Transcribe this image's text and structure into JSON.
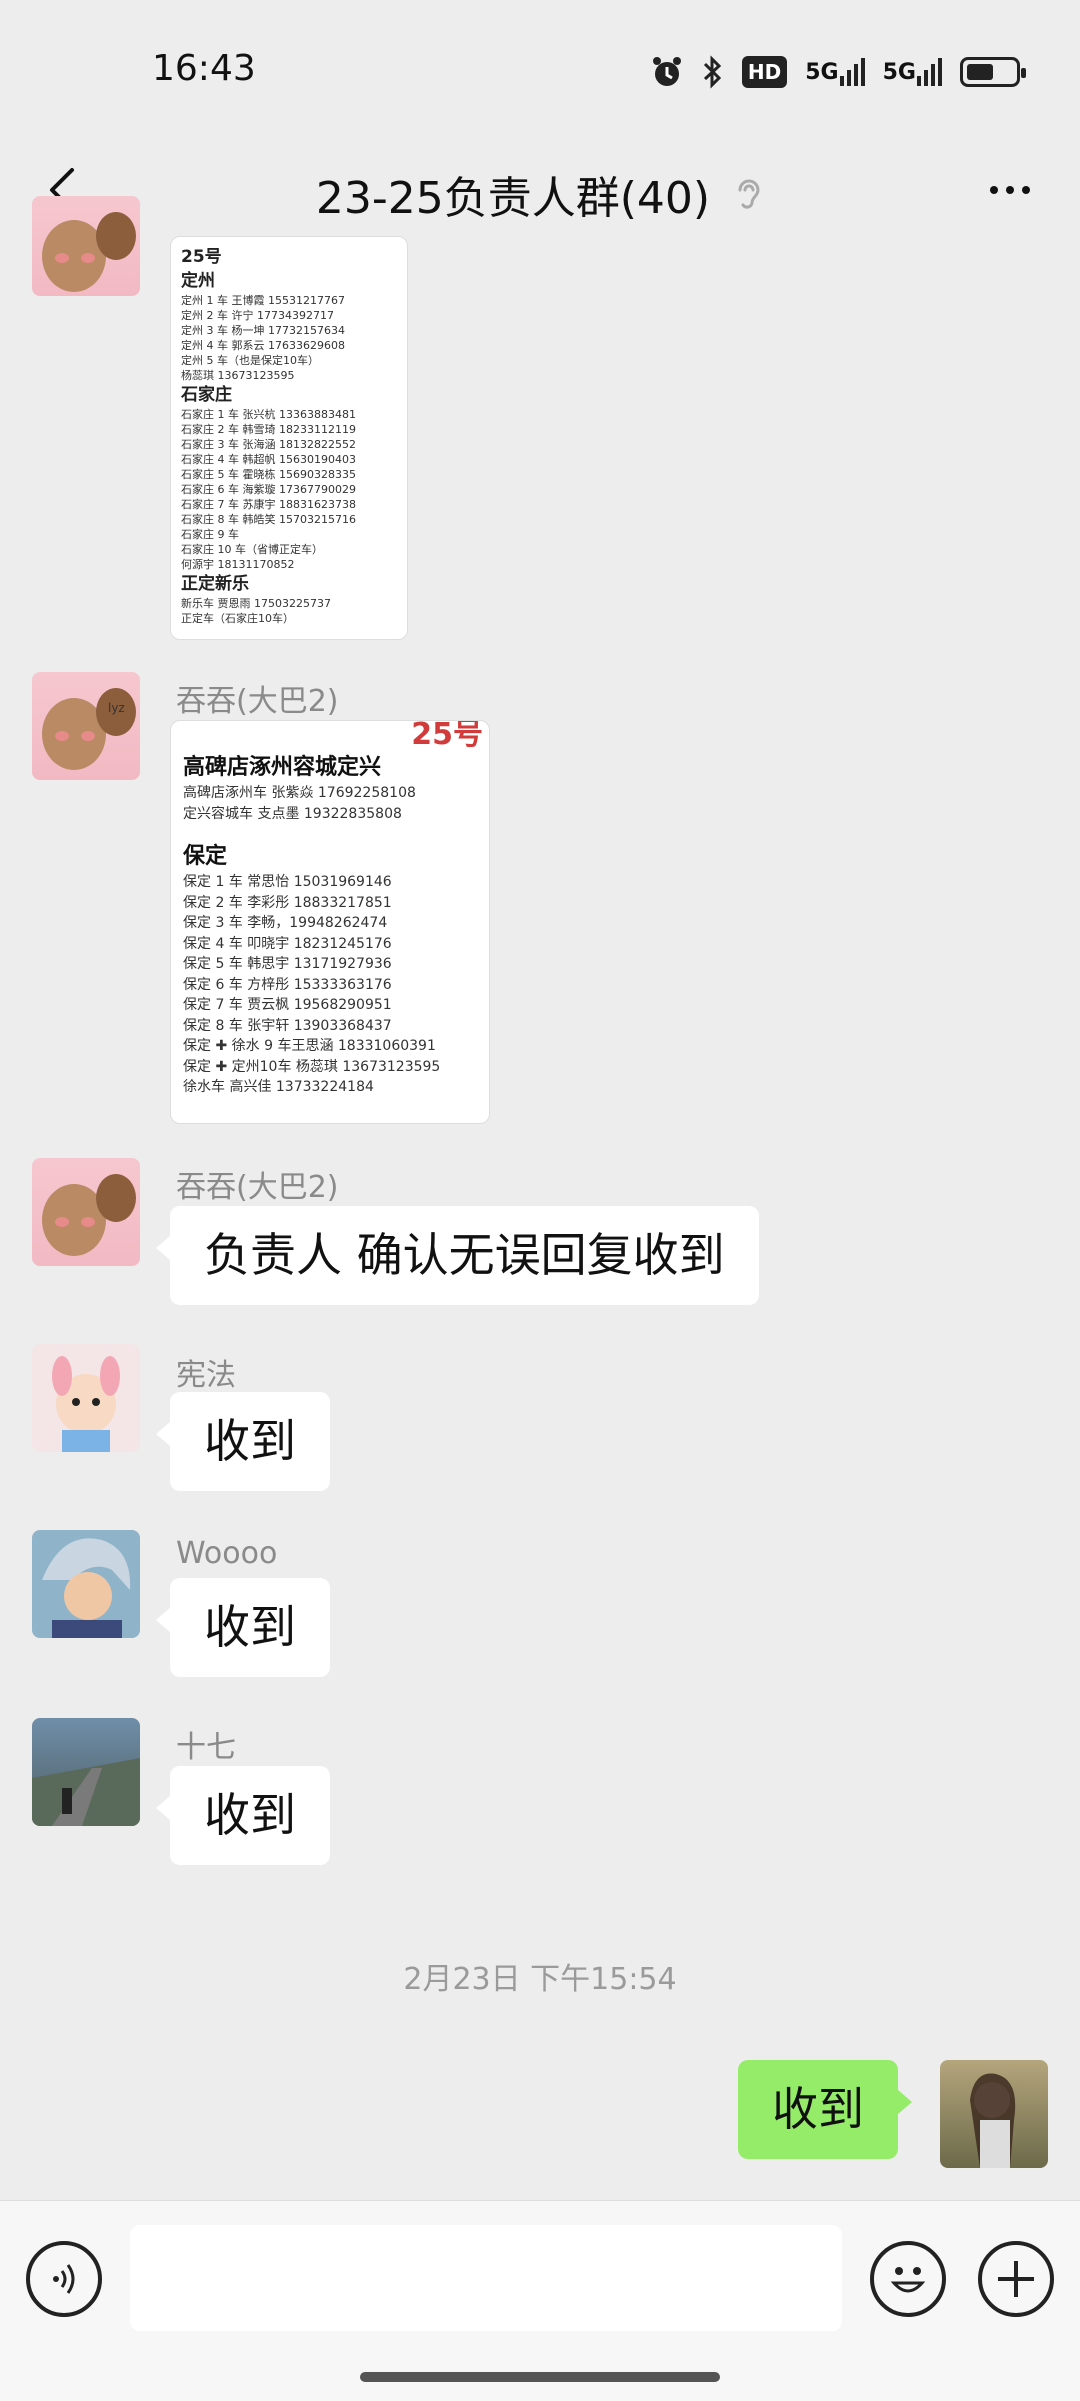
{
  "status": {
    "time": "16:43",
    "hd": "HD",
    "net1": "5G",
    "net2": "5G"
  },
  "nav": {
    "title": "23-25负责人群(40)"
  },
  "messages": {
    "m1": {
      "card": {
        "date": "25号",
        "dingzhou_title": "定州",
        "dingzhou": [
          "定州 1 车 王博霞 15531217767",
          "定州 2 车 许宁 17734392717",
          "定州 3 车 杨一坤 17732157634",
          "定州 4 车 郭系云 17633629608",
          "定州 5 车（也是保定10车）",
          "杨蕊琪 13673123595"
        ],
        "sjz_title": "石家庄",
        "sjz": [
          "石家庄 1 车 张兴杭 13363883481",
          "石家庄 2 车 韩雪琦 18233112119",
          "石家庄 3 车 张海涵 18132822552",
          "石家庄 4 车 韩超帆 15630190403",
          "石家庄 5 车 霍晓栋 15690328335",
          "石家庄 6 车 海紫璇 17367790029",
          "石家庄 7 车 苏康宇 18831623738",
          "石家庄 8 车 韩皓笑 15703215716",
          "石家庄 9 车",
          "石家庄 10 车（省博正定车）",
          "何源宇 18131170852"
        ],
        "zd_title": "正定新乐",
        "zd": [
          "新乐车 贾恩雨 17503225737",
          "正定车（石家庄10车）"
        ]
      }
    },
    "m2": {
      "sender": "吞吞(大巴2)",
      "card": {
        "num": "25号",
        "title1": "高碑店涿州容城定兴",
        "lines1": [
          "高碑店涿州车 张紫焱 17692258108",
          "定兴容城车 支点墨 19322835808"
        ],
        "title2": "保定",
        "lines2": [
          "保定 1 车 常思怡 15031969146",
          "保定 2 车 李彩彤 18833217851",
          "保定 3 车 李畅，19948262474",
          "保定 4 车 叩晓宇 18231245176",
          "保定 5 车 韩思宇 13171927936",
          "保定 6 车 方梓彤 15333363176",
          "保定 7 车 贾云枫 19568290951",
          "保定 8 车 张宇轩 13903368437",
          "保定 ✚ 徐水 9 车王思涵 18331060391",
          "保定 ✚ 定州10车 杨蕊琪 13673123595",
          "徐水车 高兴佳 13733224184"
        ]
      }
    },
    "m3": {
      "sender": "吞吞(大巴2)",
      "text": "负责人 确认无误回复收到"
    },
    "m4": {
      "sender": "宪法",
      "text": "收到"
    },
    "m5": {
      "sender": "Woooo",
      "text": "收到"
    },
    "m6": {
      "sender": "十七",
      "text": "收到"
    },
    "timestamp": "2月23日 下午15:54",
    "m7": {
      "text": "收到"
    }
  },
  "input": {
    "placeholder": ""
  }
}
